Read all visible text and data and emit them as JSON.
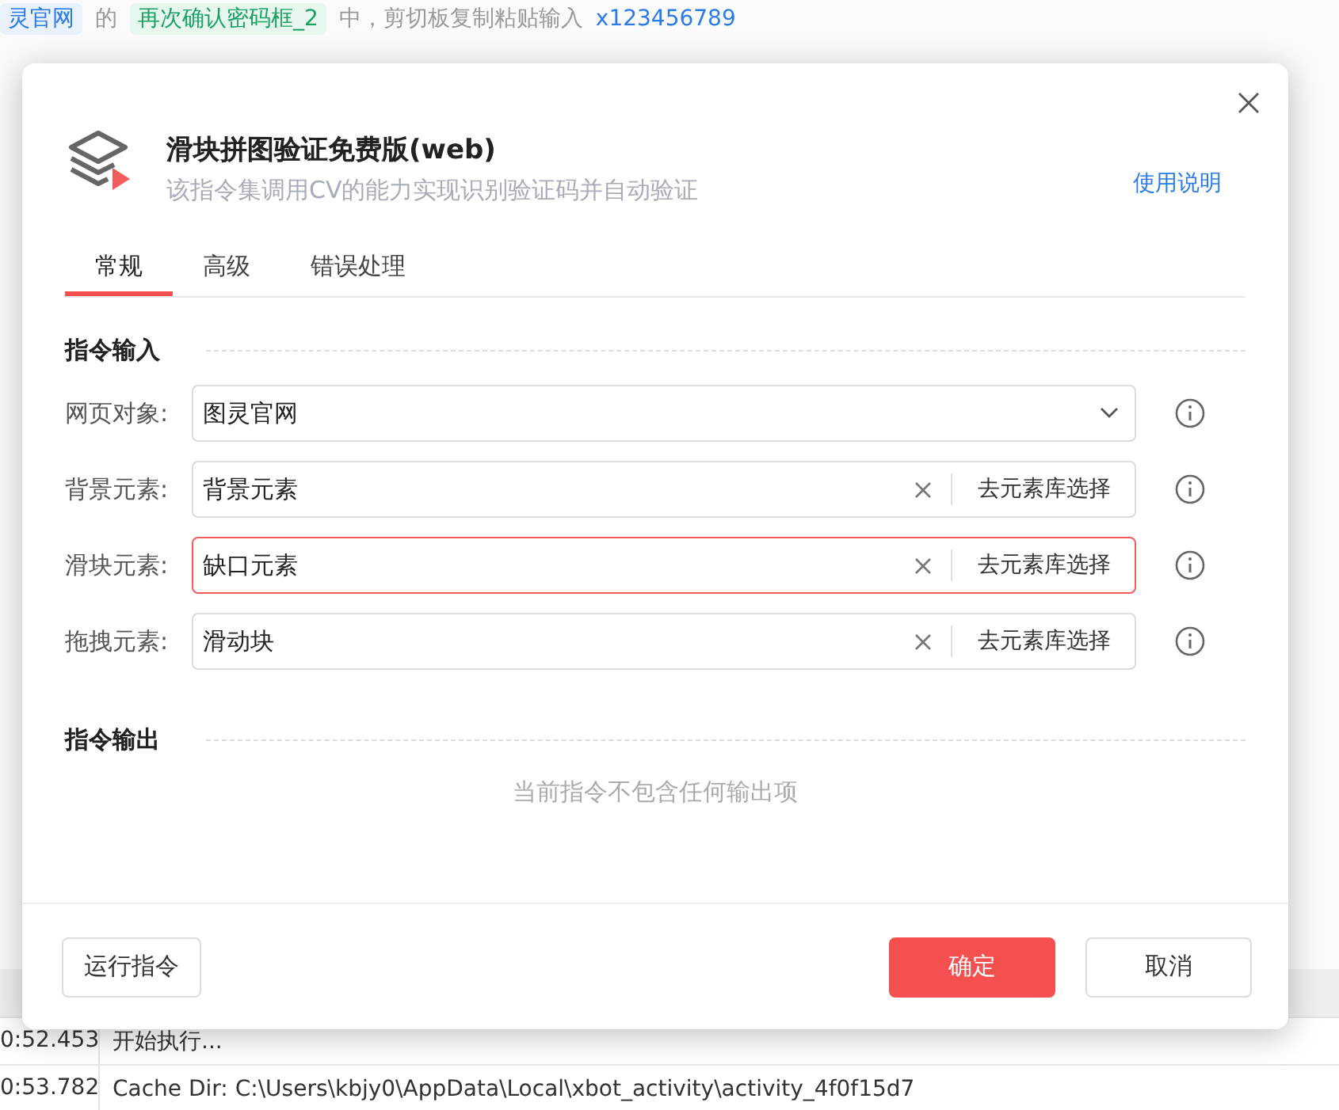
{
  "background": {
    "step_line": [
      {
        "text": "灵官网",
        "kind": "target"
      },
      {
        "text": "的",
        "kind": "plain"
      },
      {
        "text": "再次确认密码框_2",
        "kind": "element"
      },
      {
        "text": "中，剪切板复制粘贴输入",
        "kind": "plain"
      },
      {
        "text": "x123456789",
        "kind": "value"
      }
    ],
    "log_rows": [
      {
        "time": "0:52.453",
        "message": "开始执行..."
      },
      {
        "time": "0:53.782",
        "message": "Cache Dir: C:\\Users\\kbjy0\\AppData\\Local\\xbot_activity\\activity_4f0f15d7"
      }
    ]
  },
  "dialog": {
    "title": "滑块拼图验证免费版(web)",
    "subtitle": "该指令集调用CV的能力实现识别验证码并自动验证",
    "help_link": "使用说明",
    "tabs": [
      {
        "label": "常规",
        "selected": true
      },
      {
        "label": "高级",
        "selected": false
      },
      {
        "label": "错误处理",
        "selected": false
      }
    ],
    "input_section": "指令输入",
    "fields": [
      {
        "label": "网页对象:",
        "kind": "select",
        "value": "图灵官网",
        "invalid": false
      },
      {
        "label": "背景元素:",
        "kind": "element",
        "value": "背景元素",
        "action": "去元素库选择",
        "invalid": false
      },
      {
        "label": "滑块元素:",
        "kind": "element",
        "value": "缺口元素",
        "action": "去元素库选择",
        "invalid": true
      },
      {
        "label": "拖拽元素:",
        "kind": "element",
        "value": "滑动块",
        "action": "去元素库选择",
        "invalid": false
      }
    ],
    "output_section": "指令输出",
    "output_empty": "当前指令不包含任何输出项",
    "buttons": [
      {
        "label": "运行指令",
        "kind": "default"
      },
      {
        "label": "确定",
        "kind": "primary"
      },
      {
        "label": "取消",
        "kind": "default"
      }
    ]
  }
}
